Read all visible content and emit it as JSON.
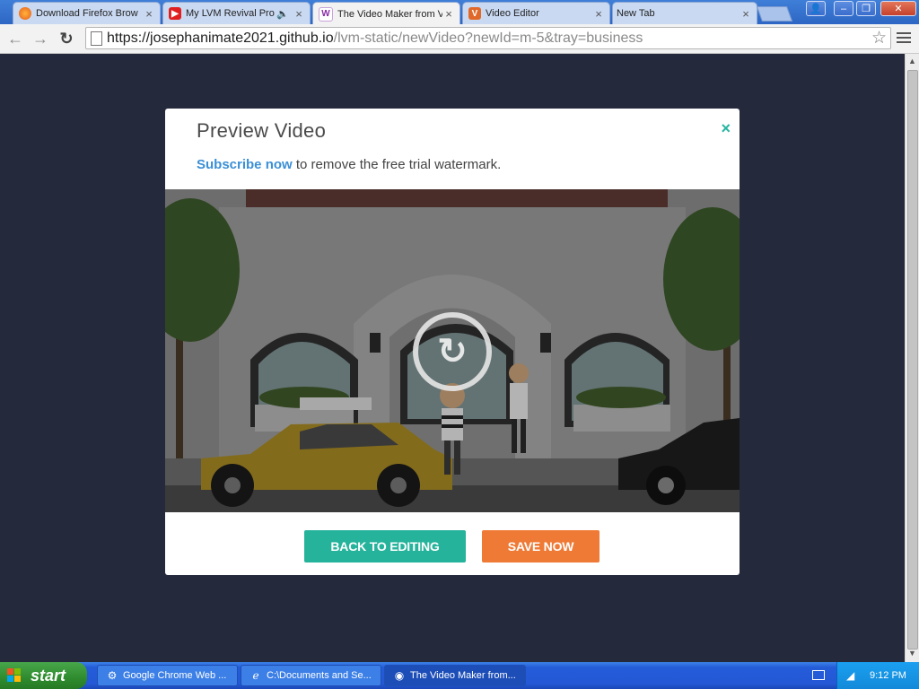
{
  "browser": {
    "tabs": [
      {
        "label": "Download Firefox Brow",
        "icon": "firefox-icon",
        "active": false
      },
      {
        "label": "My LVM Revival Pro",
        "icon": "youtube-icon",
        "active": false,
        "audio": true
      },
      {
        "label": "The Video Maker from V",
        "icon": "lvm-icon",
        "active": true
      },
      {
        "label": "Video Editor",
        "icon": "v-icon",
        "active": false
      },
      {
        "label": "New Tab",
        "icon": "",
        "active": false
      }
    ],
    "url_host": "https://josephanimate2021.github.io",
    "url_path": "/lvm-static/newVideo?newId=m-5&tray=business"
  },
  "modal": {
    "title": "Preview Video",
    "close_label": "×",
    "subscribe_link": "Subscribe now",
    "subscribe_text": " to remove the free trial watermark.",
    "back_button": "BACK TO EDITING",
    "save_button": "SAVE NOW",
    "replay_glyph": "↻"
  },
  "taskbar": {
    "start_label": "start",
    "tasks": [
      {
        "label": "Google Chrome Web ...",
        "icon": "chrome-installer-icon",
        "active": false
      },
      {
        "label": "C:\\Documents and Se...",
        "icon": "ie-icon",
        "active": false
      },
      {
        "label": "The Video Maker from...",
        "icon": "chrome-icon",
        "active": true
      }
    ],
    "clock": "9:12 PM"
  },
  "colors": {
    "accent_teal": "#26b39c",
    "accent_orange": "#ef7a35",
    "link_blue": "#3c8fd6",
    "page_bg": "#25293c"
  }
}
